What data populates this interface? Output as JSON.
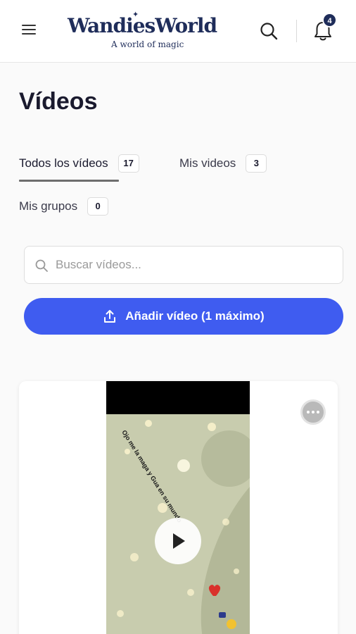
{
  "header": {
    "logo_title": "WandiesWorld",
    "logo_tagline": "A world of magic",
    "notification_count": "4",
    "icons": {
      "menu": "hamburger-icon",
      "search": "search-icon",
      "notifications": "bell-icon"
    }
  },
  "page": {
    "title": "Vídeos"
  },
  "tabs": [
    {
      "label": "Todos los vídeos",
      "count": "17",
      "active": true
    },
    {
      "label": "Mis videos",
      "count": "3",
      "active": false
    },
    {
      "label": "Mis grupos",
      "count": "0",
      "active": false
    }
  ],
  "search": {
    "placeholder": "Buscar vídeos...",
    "value": ""
  },
  "actions": {
    "add_video_label": "Añadir vídeo (1 máximo)",
    "icon": "upload-icon"
  },
  "video_card": {
    "options_icon": "more-options-icon",
    "play_icon": "play-icon",
    "overlay_text": "Ojo me la maga y Gua en su mundo"
  },
  "colors": {
    "brand_navy": "#1f2d5a",
    "primary_button": "#3f5cf0",
    "page_bg": "#fafafa",
    "video_bg": "#c9ccb0"
  }
}
